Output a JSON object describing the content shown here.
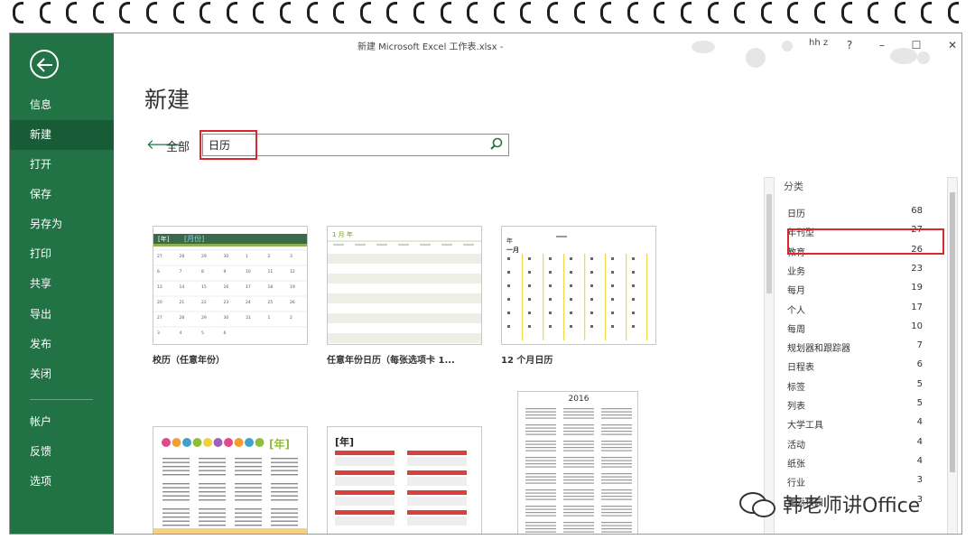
{
  "window": {
    "title": "新建 Microsoft Excel 工作表.xlsx -",
    "user": "hh z",
    "help": "?",
    "minimize": "–",
    "maximize": "☐",
    "close": "✕"
  },
  "sidebar": {
    "items": [
      {
        "label": "信息"
      },
      {
        "label": "新建"
      },
      {
        "label": "打开"
      },
      {
        "label": "保存"
      },
      {
        "label": "另存为"
      },
      {
        "label": "打印"
      },
      {
        "label": "共享"
      },
      {
        "label": "导出"
      },
      {
        "label": "发布"
      },
      {
        "label": "关闭"
      },
      {
        "label": "帐户"
      },
      {
        "label": "反馈"
      },
      {
        "label": "选项"
      }
    ],
    "active": "新建"
  },
  "main": {
    "title": "新建",
    "all_link": "全部",
    "search_value": "日历"
  },
  "templates": [
    {
      "label": "校历（任意年份）",
      "header_tag": "[年]",
      "header_month": "[月份]",
      "day_numbers": [
        "27",
        "28",
        "29",
        "30",
        "1",
        "2",
        "3",
        "6",
        "7",
        "8",
        "9",
        "10",
        "11",
        "12",
        "13",
        "14",
        "15",
        "16",
        "17",
        "18",
        "19",
        "20",
        "21",
        "22",
        "23",
        "24",
        "25",
        "26",
        "27",
        "28",
        "29",
        "30",
        "31",
        "1",
        "2",
        "3",
        "4",
        "5",
        "6"
      ]
    },
    {
      "label": "任意年份日历（每张选项卡 1...",
      "header": "1 月 年"
    },
    {
      "label": "12 个月日历",
      "header_year": "年",
      "header_month": "一月"
    },
    {
      "label": "",
      "header_tag": "[年]"
    },
    {
      "label": "",
      "header_tag": "[年]"
    },
    {
      "label": "",
      "header_year": "2016"
    }
  ],
  "categories": {
    "header": "分类",
    "items": [
      {
        "name": "日历",
        "count": "68"
      },
      {
        "name": "年刊型",
        "count": "27"
      },
      {
        "name": "教育",
        "count": "26"
      },
      {
        "name": "业务",
        "count": "23"
      },
      {
        "name": "每月",
        "count": "19"
      },
      {
        "name": "个人",
        "count": "17"
      },
      {
        "name": "每周",
        "count": "10"
      },
      {
        "name": "规划器和跟踪器",
        "count": "7"
      },
      {
        "name": "日程表",
        "count": "6"
      },
      {
        "name": "标签",
        "count": "5"
      },
      {
        "name": "列表",
        "count": "5"
      },
      {
        "name": "大学工具",
        "count": "4"
      },
      {
        "name": "活动",
        "count": "4"
      },
      {
        "name": "纸张",
        "count": "4"
      },
      {
        "name": "行业",
        "count": "3"
      },
      {
        "name": "重返校园",
        "count": "3"
      }
    ]
  },
  "watermark": "韩老师讲Office",
  "colors": {
    "sidebar": "#217346",
    "sidebar_active": "#185c37",
    "highlight": "#d9272e"
  }
}
